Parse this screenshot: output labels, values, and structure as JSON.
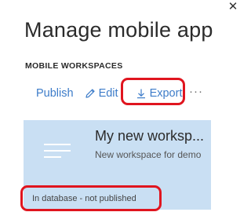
{
  "panel": {
    "close_icon": "close-icon",
    "title": "Manage mobile app"
  },
  "section": {
    "label": "MOBILE WORKSPACES"
  },
  "toolbar": {
    "publish_label": "Publish",
    "edit_label": "Edit",
    "edit_icon": "pencil-icon",
    "export_label": "Export",
    "export_icon": "download-arrow-icon",
    "more_label": "···",
    "link_color": "#3d7cc9"
  },
  "workspace_card": {
    "icon": "list-lines-icon",
    "title": "My new worksp...",
    "description": "New workspace for demo",
    "status": "In database - not published",
    "background_color": "#c9dff3"
  },
  "annotations": {
    "highlight_color": "#e0151f"
  }
}
